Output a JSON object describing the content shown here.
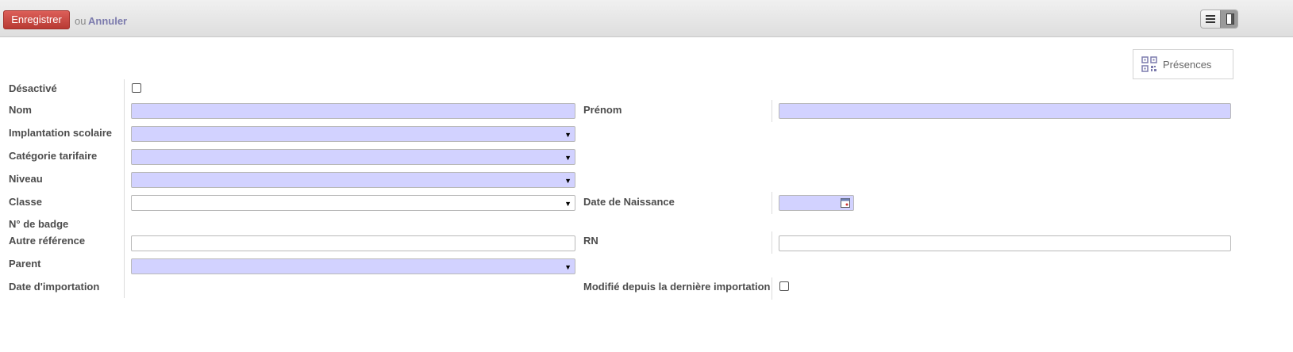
{
  "toolbar": {
    "save_label": "Enregistrer",
    "or_label": "ou",
    "cancel_label": "Annuler",
    "views": [
      "list-icon",
      "form-icon"
    ]
  },
  "smart_button": {
    "label": "Présences",
    "icon": "qr-code-icon"
  },
  "form": {
    "left": [
      {
        "label": "Désactivé",
        "widget": "checkbox",
        "checked": false
      },
      {
        "label": "Nom",
        "widget": "char",
        "value": "",
        "required": true
      },
      {
        "label": "Implantation scolaire",
        "widget": "select",
        "value": "",
        "required": true
      },
      {
        "label": "Catégorie tarifaire",
        "widget": "select",
        "value": "",
        "required": true
      },
      {
        "label": "Niveau",
        "widget": "select",
        "value": "",
        "required": true
      },
      {
        "label": "Classe",
        "widget": "select",
        "value": "",
        "required": false
      },
      {
        "label": "N° de badge",
        "widget": "readonly",
        "value": ""
      },
      {
        "label": "Autre référence",
        "widget": "char",
        "value": "",
        "required": false
      },
      {
        "label": "Parent",
        "widget": "select",
        "value": "",
        "required": true
      },
      {
        "label": "Date d'importation",
        "widget": "readonly",
        "value": ""
      }
    ],
    "right": [
      {
        "label": "Prénom",
        "widget": "char",
        "value": "",
        "required": true
      },
      {
        "label": "Date de Naissance",
        "widget": "date",
        "value": "",
        "required": true
      },
      {
        "label": "RN",
        "widget": "char",
        "value": "",
        "required": false
      },
      {
        "label": "Modifié depuis la dernière importation",
        "widget": "checkbox",
        "checked": false
      }
    ]
  },
  "colors": {
    "required_bg": "#d2d2ff",
    "save_bg": "#c0433c",
    "link": "#7c7bad"
  }
}
